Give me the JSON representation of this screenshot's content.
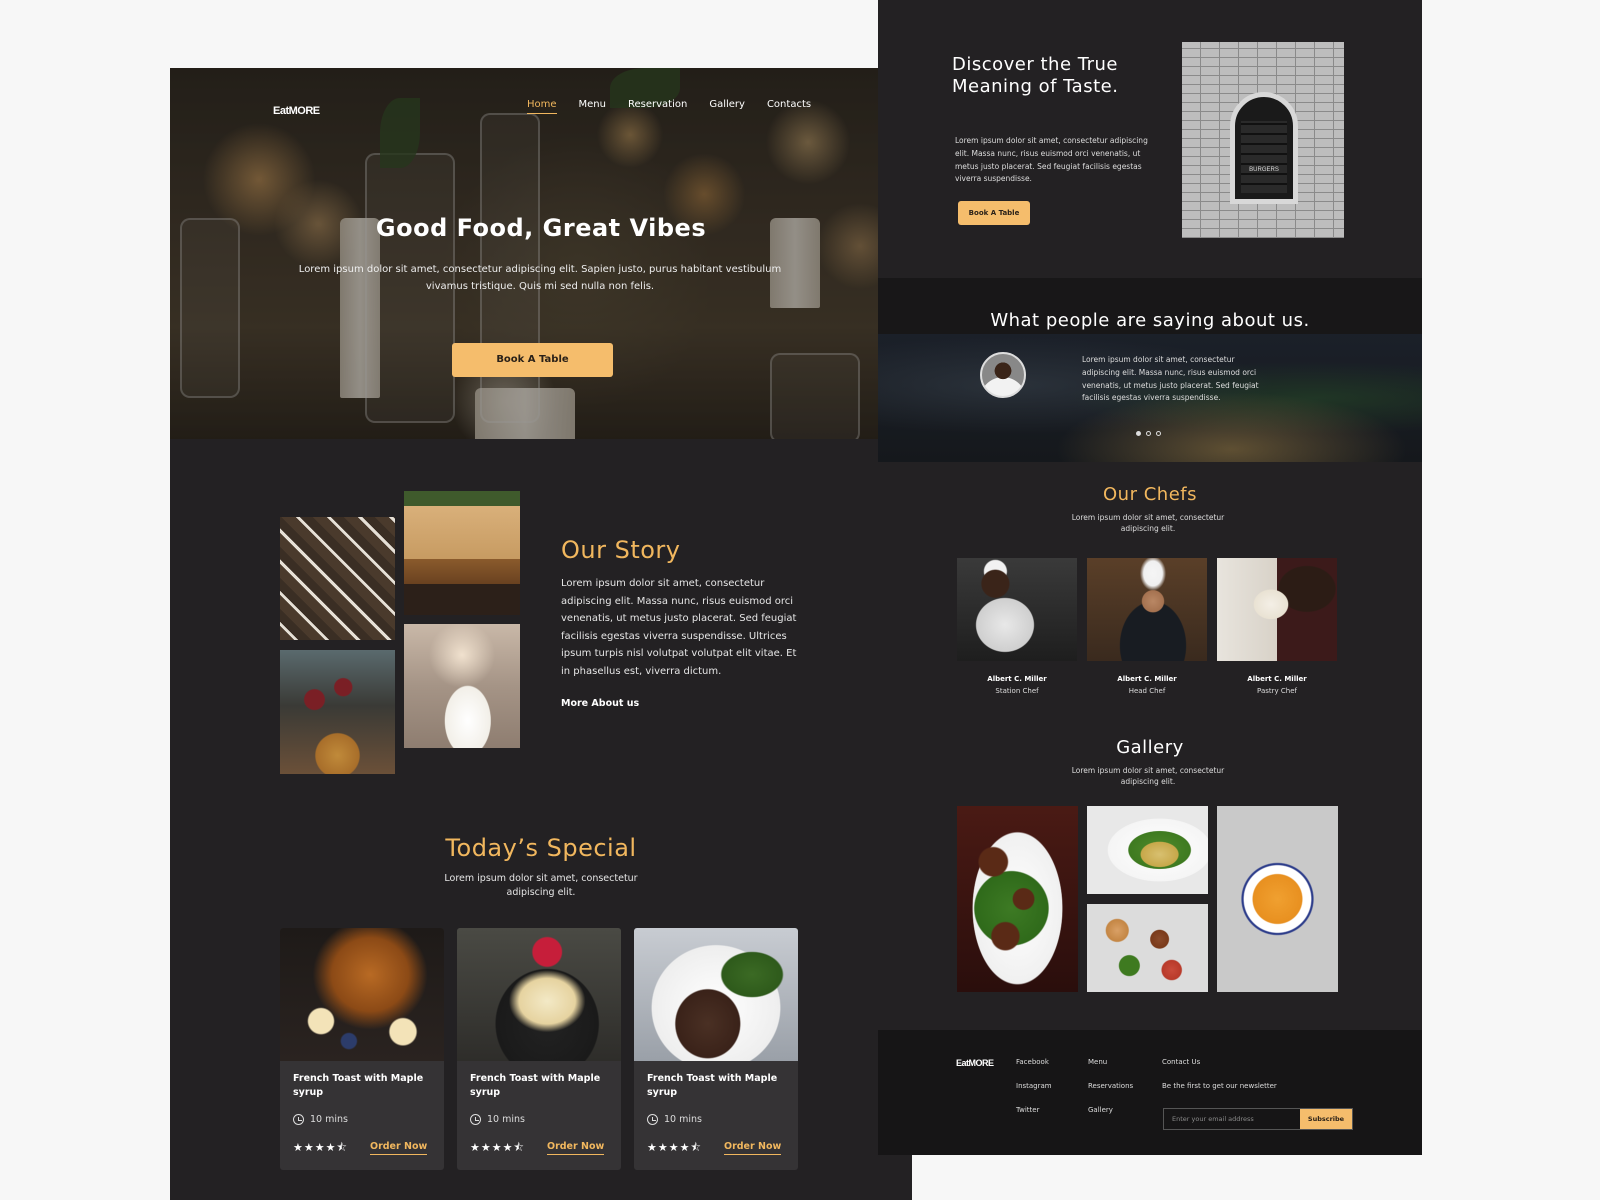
{
  "left": {
    "logo": "EatMORE",
    "nav": [
      "Home",
      "Menu",
      "Reservation",
      "Gallery",
      "Contacts"
    ],
    "hero": {
      "title": "Good Food, Great Vibes",
      "subtitle": "Lorem ipsum dolor sit amet, consectetur adipiscing elit. Sapien justo, purus habitant vestibulum vivamus tristique. Quis mi sed nulla non felis.",
      "button": "Book A Table"
    },
    "story": {
      "title": "Our Story",
      "text": "Lorem ipsum dolor sit amet, consectetur adipiscing elit. Massa nunc, risus euismod orci venenatis, ut metus justo placerat. Sed feugiat facilisis egestas viverra suspendisse. Ultrices ipsum turpis nisl volutpat volutpat elit vitae. Et in phasellus est, viverra dictum.",
      "link": "More About us"
    },
    "special": {
      "title": "Today’s Special",
      "subtitle": "Lorem ipsum dolor sit amet, consectetur adipiscing elit.",
      "cards": [
        {
          "title": "French Toast with Maple syrup",
          "time": "10 mins",
          "stars": "★★★★⯪",
          "rating": 4.5,
          "order": "Order Now"
        },
        {
          "title": "French Toast with Maple syrup",
          "time": "10 mins",
          "stars": "★★★★⯪",
          "rating": 4.5,
          "order": "Order Now"
        },
        {
          "title": "French Toast with Maple syrup",
          "time": "10 mins",
          "stars": "★★★★⯪",
          "rating": 4.5,
          "order": "Order Now"
        }
      ]
    }
  },
  "right": {
    "discover": {
      "title": "Discover the True Meaning of Taste.",
      "text": "Lorem ipsum dolor sit amet, consectetur adipiscing elit. Massa nunc, risus euismod orci venenatis, ut metus justo placerat. Sed feugiat facilisis egestas viverra suspendisse.",
      "button": "Book A Table",
      "sign": "BURGERS"
    },
    "testimonials": {
      "title": "What people are saying about us.",
      "text": "Lorem ipsum dolor sit amet, consectetur adipiscing elit. Massa nunc, risus euismod orci venenatis, ut metus justo placerat. Sed feugiat facilisis egestas viverra suspendisse."
    },
    "chefs": {
      "title": "Our Chefs",
      "subtitle": "Lorem ipsum dolor sit amet, consectetur adipiscing elit.",
      "items": [
        {
          "name": "Albert C. Miller",
          "role": "Station Chef"
        },
        {
          "name": "Albert C. Miller",
          "role": "Head Chef"
        },
        {
          "name": "Albert C. Miller",
          "role": "Pastry Chef"
        }
      ]
    },
    "gallery": {
      "title": "Gallery",
      "subtitle": "Lorem ipsum dolor sit amet, consectetur adipiscing elit."
    },
    "footer": {
      "logo": "EatMORE",
      "col1": [
        "Facebook",
        "Instagram",
        "Twitter"
      ],
      "col2": [
        "Menu",
        "Reservations",
        "Gallery"
      ],
      "contact_title": "Contact Us",
      "newsletter": "Be the first to get our newsletter",
      "email_placeholder": "Enter your email address",
      "subscribe": "Subscribe"
    }
  },
  "colors": {
    "accent": "#f5bd6c",
    "accent_text": "#f1b75e",
    "page_bg": "#232123",
    "card_bg": "#353335"
  }
}
